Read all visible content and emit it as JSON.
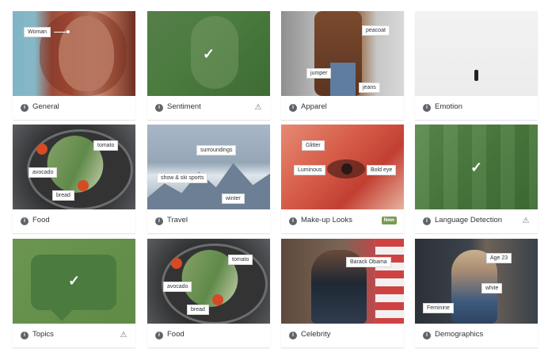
{
  "cards": [
    {
      "label": "General",
      "tags": [
        "Woman"
      ],
      "badge": "",
      "warning": false
    },
    {
      "label": "Sentiment",
      "tags": [],
      "badge": "",
      "warning": true
    },
    {
      "label": "Apparel",
      "tags": [
        "peacoat",
        "jumper",
        "jeans"
      ],
      "badge": "",
      "warning": false
    },
    {
      "label": "Emotion",
      "tags": [],
      "badge": "",
      "warning": false
    },
    {
      "label": "Food",
      "tags": [
        "tomato",
        "avocado",
        "bread"
      ],
      "badge": "",
      "warning": false
    },
    {
      "label": "Travel",
      "tags": [
        "surroundings",
        "show & ski sports",
        "winter"
      ],
      "badge": "",
      "warning": false
    },
    {
      "label": "Make-up Looks",
      "tags": [
        "Glitter",
        "Luminous",
        "Bold eye"
      ],
      "badge": "New",
      "warning": false
    },
    {
      "label": "Language Detection",
      "tags": [],
      "badge": "",
      "warning": true
    },
    {
      "label": "Topics",
      "tags": [],
      "badge": "",
      "warning": true
    },
    {
      "label": "Food",
      "tags": [
        "tomato",
        "avocado",
        "bread"
      ],
      "badge": "",
      "warning": false
    },
    {
      "label": "Celebrity",
      "tags": [
        "Barack Obama"
      ],
      "badge": "",
      "warning": false
    },
    {
      "label": "Demographics",
      "tags": [
        "Age 23",
        "white",
        "Feminine"
      ],
      "badge": "",
      "warning": false
    }
  ],
  "colors": {
    "overlay_green": "#4b7b3e",
    "caption_text": "#2f3337",
    "info_icon": "#5f646b",
    "badge_new": "#7a9a54"
  },
  "icons": {
    "info": "info-icon",
    "warning": "warning-icon",
    "check": "check-icon"
  }
}
